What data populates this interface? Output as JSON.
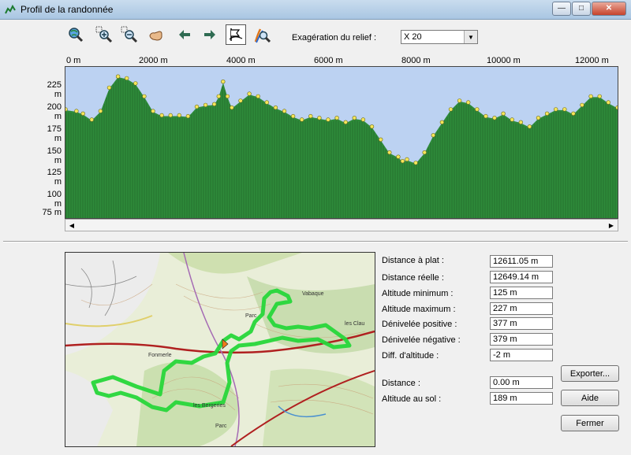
{
  "window": {
    "title": "Profil de la randonnée",
    "minimize": "—",
    "maximize": "□",
    "close": "✕"
  },
  "toolbar": {
    "tools": [
      "zoom-globe-icon",
      "zoom-in-icon",
      "zoom-out-icon",
      "pan-hand-icon",
      "arrow-left-icon",
      "arrow-right-icon",
      "profile-mode-icon",
      "locate-icon"
    ],
    "relief_label": "Exagération du relief :",
    "relief_value": "X 20"
  },
  "chart_data": {
    "type": "area",
    "title": "",
    "xlabel": "",
    "ylabel": "",
    "x_ticks": [
      "0 m",
      "2000 m",
      "4000 m",
      "6000 m",
      "8000 m",
      "10000 m",
      "12000 m"
    ],
    "y_ticks": [
      "225 m",
      "200 m",
      "175 m",
      "150 m",
      "125 m",
      "100 m",
      "75 m"
    ],
    "xlim": [
      0,
      12611
    ],
    "ylim": [
      65,
      240
    ],
    "colors": {
      "fill": "#2e8b3a",
      "sky": "#bcd2f2",
      "marker": "#f5e65a"
    },
    "series": [
      {
        "x": [
          0,
          250,
          400,
          600,
          800,
          1000,
          1200,
          1400,
          1600,
          1800,
          2000,
          2200,
          2400,
          2600,
          2800,
          3000,
          3200,
          3400,
          3500,
          3600,
          3700,
          3800,
          4000,
          4200,
          4400,
          4600,
          4800,
          5000,
          5200,
          5400,
          5600,
          5800,
          6000,
          6200,
          6400,
          6600,
          6800,
          7000,
          7200,
          7400,
          7600,
          7700,
          7800,
          8000,
          8200,
          8400,
          8600,
          8800,
          9000,
          9200,
          9400,
          9600,
          9800,
          10000,
          10200,
          10400,
          10600,
          10800,
          11000,
          11200,
          11400,
          11600,
          11800,
          12000,
          12200,
          12400,
          12611
        ],
        "y": [
          190,
          188,
          185,
          178,
          188,
          215,
          228,
          226,
          220,
          205,
          188,
          183,
          183,
          183,
          182,
          193,
          195,
          196,
          205,
          222,
          205,
          192,
          200,
          208,
          205,
          198,
          192,
          188,
          182,
          178,
          182,
          180,
          178,
          180,
          175,
          180,
          178,
          170,
          155,
          140,
          135,
          130,
          132,
          128,
          140,
          160,
          175,
          190,
          200,
          198,
          190,
          182,
          180,
          185,
          178,
          175,
          170,
          180,
          185,
          190,
          190,
          185,
          195,
          205,
          205,
          198,
          192
        ]
      }
    ]
  },
  "stats": [
    {
      "label": "Distance à plat :",
      "value": "12611.05 m"
    },
    {
      "label": "Distance réelle :",
      "value": "12649.14 m"
    },
    {
      "label": "Altitude minimum :",
      "value": "125 m"
    },
    {
      "label": "Altitude maximum :",
      "value": "227 m"
    },
    {
      "label": "Dénivelée positive :",
      "value": "377 m"
    },
    {
      "label": "Dénivelée négative :",
      "value": "379 m"
    },
    {
      "label": "Diff. d'altitude :",
      "value": "-2 m"
    }
  ],
  "cursor": [
    {
      "label": "Distance :",
      "value": "0.00 m"
    },
    {
      "label": "Altitude au sol :",
      "value": "189 m"
    }
  ],
  "buttons": {
    "export": "Exporter...",
    "help": "Aide",
    "close": "Fermer"
  },
  "map": {
    "labels": [
      "Parc",
      "Vabaque",
      "les Clau",
      "Fonmerle",
      "Parc",
      "les Bergeries"
    ]
  }
}
